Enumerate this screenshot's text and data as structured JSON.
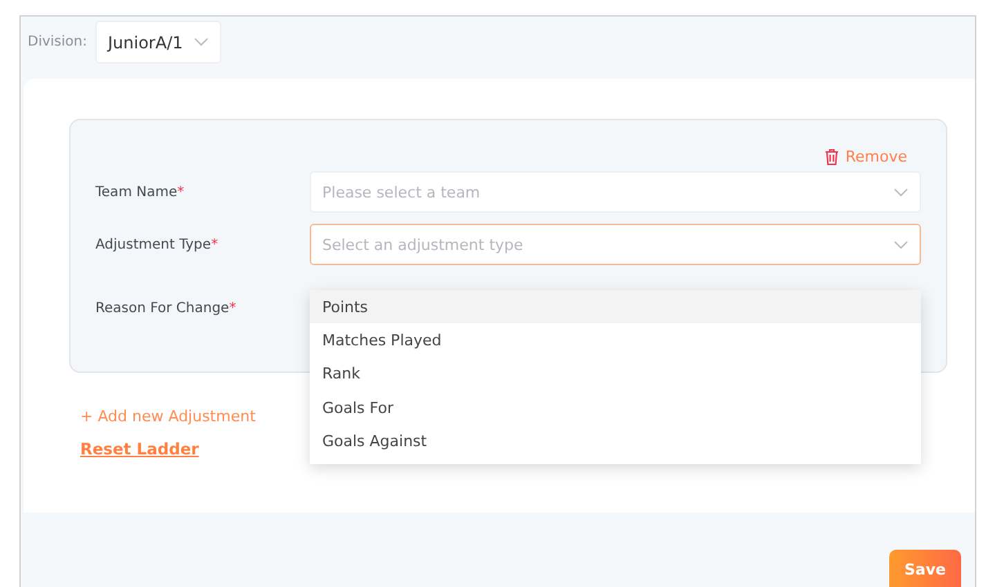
{
  "division": {
    "label": "Division:",
    "value": "JuniorA/1"
  },
  "adjustment": {
    "remove": "Remove",
    "fields": [
      {
        "label": "Team Name",
        "required": "*",
        "placeholder": "Please select a team",
        "focused": false
      },
      {
        "label": "Adjustment Type",
        "required": "*",
        "placeholder": "Select an adjustment type",
        "focused": true
      },
      {
        "label": "Reason For Change",
        "required": "*"
      }
    ],
    "dropdown": [
      {
        "label": "Points",
        "selected": true
      },
      {
        "label": "Matches Played",
        "selected": false
      },
      {
        "label": "Rank",
        "selected": false
      },
      {
        "label": "Goals For",
        "selected": false
      },
      {
        "label": "Goals Against",
        "selected": false
      }
    ]
  },
  "add_link": "+ Add new Adjustment",
  "reset_link": "Reset Ladder",
  "save": "Save"
}
